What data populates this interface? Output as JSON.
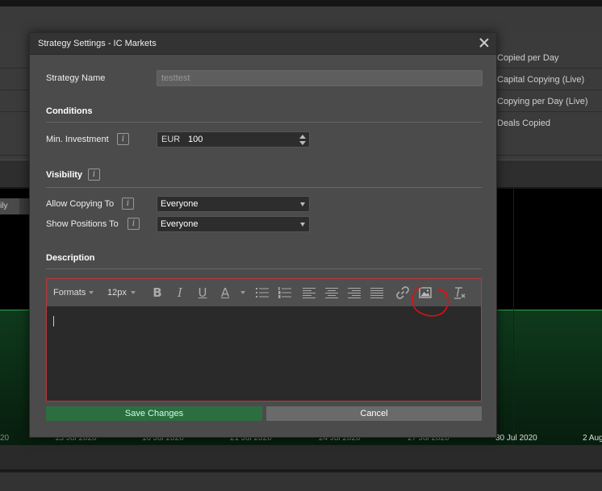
{
  "background": {
    "stats": [
      "Copied per Day",
      "Capital Copying (Live)",
      "Copying per Day (Live)",
      "Deals Copied"
    ],
    "subtab_label": "ily",
    "x_axis_labels": [
      "20",
      "13 Jul 2020",
      "16 Jul 2020",
      "21 Jul 2020",
      "24 Jul 2020",
      "27 Jul 2020",
      "30 Jul 2020",
      "2 Aug"
    ]
  },
  "modal": {
    "title": "Strategy Settings - IC Markets",
    "strategy_name_label": "Strategy Name",
    "strategy_name_placeholder": "testtest",
    "conditions_heading": "Conditions",
    "min_investment_label": "Min. Investment",
    "currency": "EUR",
    "min_investment_value": "100",
    "visibility_heading": "Visibility",
    "allow_copying_label": "Allow Copying To",
    "allow_copying_value": "Everyone",
    "show_positions_label": "Show Positions To",
    "show_positions_value": "Everyone",
    "description_heading": "Description",
    "info_glyph": "i",
    "editor": {
      "formats_label": "Formats",
      "font_size_label": "12px",
      "tools": [
        "bold-icon",
        "italic-icon",
        "underline-icon",
        "text-color-icon",
        "bullet-list-icon",
        "numbered-list-icon",
        "align-left-icon",
        "align-center-icon",
        "align-right-icon",
        "align-justify-icon",
        "link-icon",
        "image-icon",
        "clear-format-icon"
      ],
      "body_text": ""
    },
    "save_label": "Save Changes",
    "cancel_label": "Cancel"
  },
  "colors": {
    "save_button": "#2c6e3f",
    "editor_border": "#b73a3a",
    "annotation_red": "#e01010",
    "chart_line": "#2ea84e"
  }
}
